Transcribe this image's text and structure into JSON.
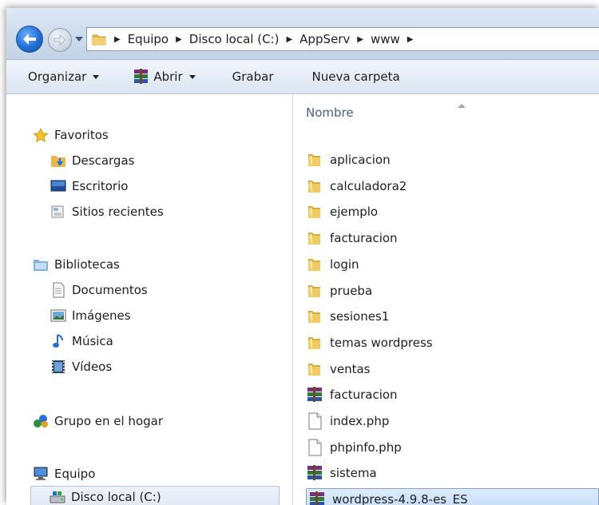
{
  "address": {
    "path": [
      "Equipo",
      "Disco local (C:)",
      "AppServ",
      "www"
    ]
  },
  "toolbar": {
    "organize": "Organizar",
    "open": "Abrir",
    "burn": "Grabar",
    "new_folder": "Nueva carpeta"
  },
  "nav": {
    "favorites": "Favoritos",
    "downloads": "Descargas",
    "desktop": "Escritorio",
    "recent": "Sitios recientes",
    "libraries": "Bibliotecas",
    "documents": "Documentos",
    "pictures": "Imágenes",
    "music": "Música",
    "videos": "Vídeos",
    "homegroup": "Grupo en el hogar",
    "computer": "Equipo",
    "local_disk": "Disco local (C:)"
  },
  "content": {
    "column_header": "Nombre",
    "items": [
      {
        "name": "aplicacion",
        "icon": "folder-icon"
      },
      {
        "name": "calculadora2",
        "icon": "folder-icon"
      },
      {
        "name": "ejemplo",
        "icon": "folder-icon"
      },
      {
        "name": "facturacion",
        "icon": "folder-icon"
      },
      {
        "name": "login",
        "icon": "folder-icon"
      },
      {
        "name": "prueba",
        "icon": "folder-icon"
      },
      {
        "name": "sesiones1",
        "icon": "folder-icon"
      },
      {
        "name": "temas wordpress",
        "icon": "folder-icon"
      },
      {
        "name": "ventas",
        "icon": "folder-icon"
      },
      {
        "name": "facturacion",
        "icon": "rar-archive-icon"
      },
      {
        "name": "index.php",
        "icon": "file-icon"
      },
      {
        "name": "phpinfo.php",
        "icon": "file-icon"
      },
      {
        "name": "sistema",
        "icon": "rar-archive-icon"
      },
      {
        "name": "wordpress-4.9.8-es_ES",
        "icon": "rar-archive-icon"
      }
    ]
  }
}
